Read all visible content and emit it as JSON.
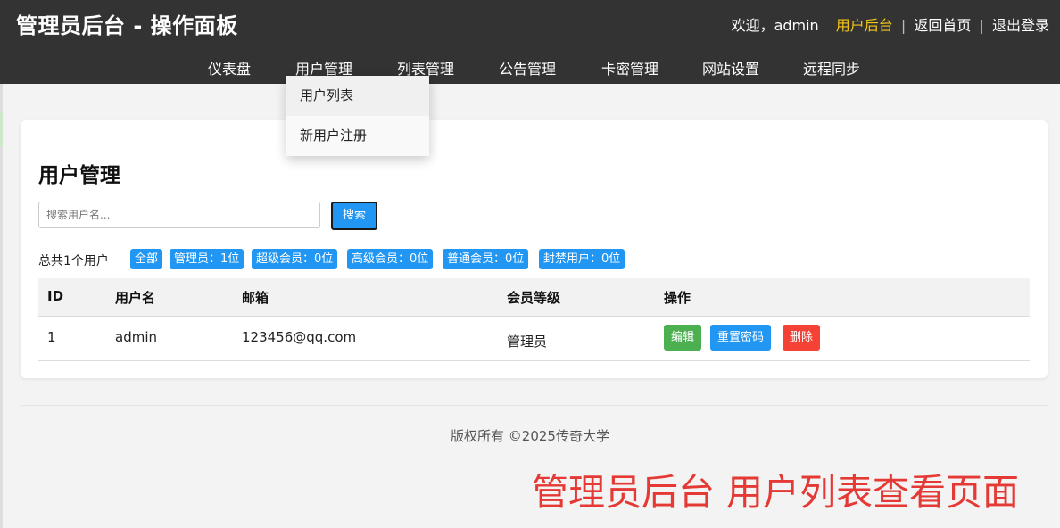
{
  "header": {
    "title": "管理员后台 - 操作面板",
    "welcome": "欢迎，admin",
    "links": [
      "用户后台",
      "返回首页",
      "退出登录"
    ],
    "separator": "|",
    "active_link_color": "#f5c518"
  },
  "nav": {
    "items": [
      "仪表盘",
      "用户管理",
      "列表管理",
      "公告管理",
      "卡密管理",
      "网站设置",
      "远程同步"
    ]
  },
  "dropdown": {
    "items": [
      "用户列表",
      "新用户注册"
    ]
  },
  "main": {
    "title": "用户管理",
    "search": {
      "placeholder": "搜索用户名...",
      "button": "搜索"
    },
    "total": "总共1个用户",
    "filters": [
      "全部",
      "管理员：1位",
      "超级会员：0位",
      "高级会员：0位",
      "普通会员：0位",
      "封禁用户：0位"
    ],
    "table": {
      "columns": [
        "ID",
        "用户名",
        "邮箱",
        "会员等级",
        "操作"
      ],
      "rows": [
        {
          "id": "1",
          "username": "admin",
          "email": "123456@qq.com",
          "level": "管理员"
        }
      ],
      "actions": [
        "编辑",
        "重置密码",
        "删除"
      ]
    }
  },
  "footer": {
    "copyright": "版权所有 ©2025传奇大学"
  },
  "annotation": "管理员后台 用户列表查看页面",
  "colors": {
    "header_bg": "#333333",
    "primary": "#2196f3",
    "success": "#4caf50",
    "danger": "#f44336",
    "annotation": "#e53935"
  }
}
